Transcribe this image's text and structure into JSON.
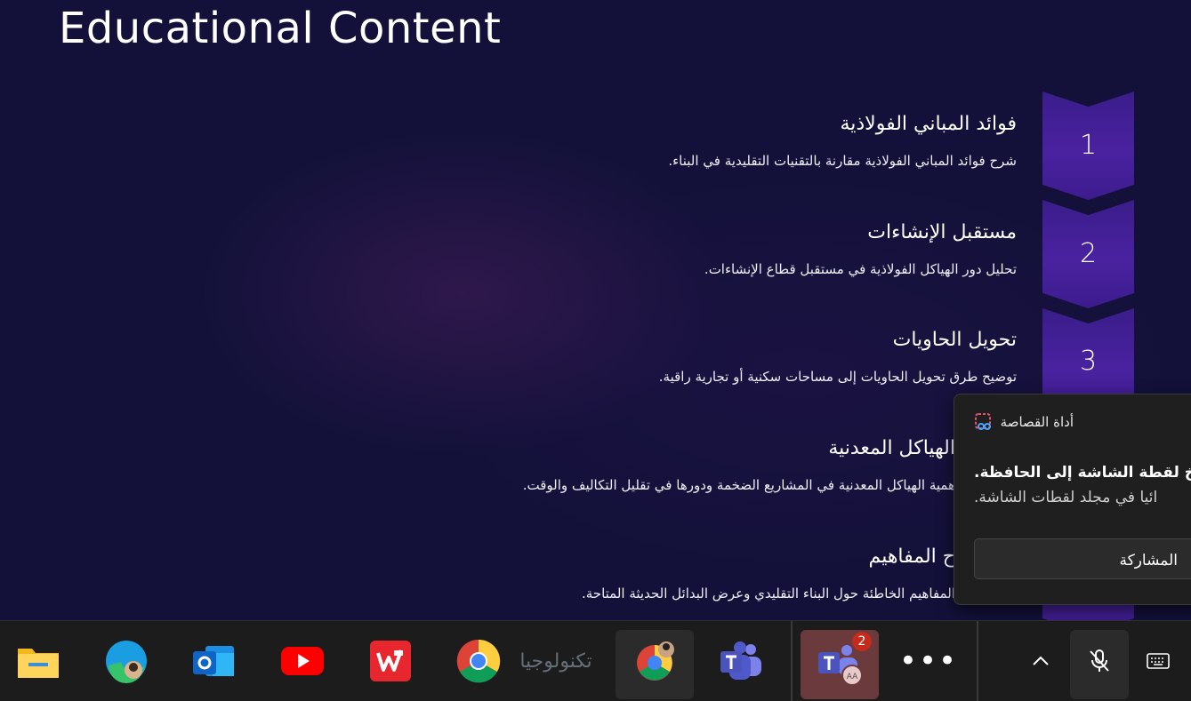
{
  "slide": {
    "title": "Educational Content",
    "items": [
      {
        "number": "1",
        "title": "فوائد المباني الفولاذية",
        "description": "شرح فوائد المباني الفولاذية مقارنة بالتقنيات التقليدية في البناء."
      },
      {
        "number": "2",
        "title": "مستقبل الإنشاءات",
        "description": "تحليل دور الهياكل الفولاذية في مستقبل قطاع الإنشاءات."
      },
      {
        "number": "3",
        "title": "تحويل الحاويات",
        "description": "توضيح طرق تحويل الحاويات إلى مساحات سكنية أو تجارية راقية."
      },
      {
        "number": "",
        "title": "الهياكل المعدنية",
        "description": "همية الهياكل المعدنية في المشاريع الضخمة ودورها في تقليل التكاليف والوقت."
      },
      {
        "number": "",
        "title": "ح المفاهيم",
        "description": "المفاهيم الخاطئة حول البناء التقليدي وعرض البدائل الحديثة المتاحة."
      }
    ]
  },
  "toast": {
    "app_name": "أداة القصاصة",
    "title": "خ لقطة الشاشة إلى الحافظة.",
    "body": "ائيا في مجلد لقطات الشاشة.",
    "button": "المشاركة"
  },
  "taskbar": {
    "apps": [
      {
        "name": "file-explorer-icon"
      },
      {
        "name": "edge-icon"
      },
      {
        "name": "outlook-icon"
      },
      {
        "name": "youtube-icon"
      },
      {
        "name": "wps-icon"
      },
      {
        "name": "chrome-icon"
      },
      {
        "name": "chrome-profile-icon"
      },
      {
        "name": "teams-icon"
      },
      {
        "name": "teams-work-icon",
        "badge": "2",
        "avatar": "AA"
      },
      {
        "name": "more-icon"
      }
    ],
    "watermark": "تكنولوجيا"
  },
  "colors": {
    "accent_purple": "#4a22a0",
    "taskbar": "#1c1c1c",
    "badge_red": "#c42b1c"
  }
}
